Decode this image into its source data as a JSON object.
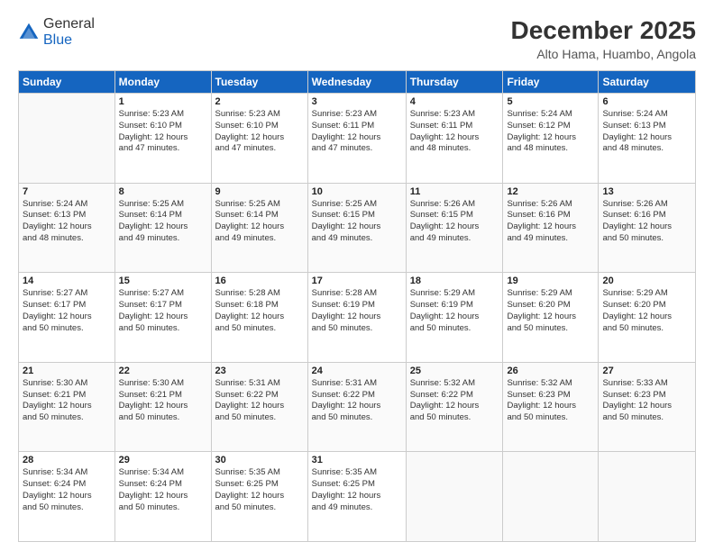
{
  "header": {
    "logo_general": "General",
    "logo_blue": "Blue",
    "month_title": "December 2025",
    "location": "Alto Hama, Huambo, Angola"
  },
  "days_of_week": [
    "Sunday",
    "Monday",
    "Tuesday",
    "Wednesday",
    "Thursday",
    "Friday",
    "Saturday"
  ],
  "weeks": [
    [
      {
        "day": "",
        "info": ""
      },
      {
        "day": "1",
        "info": "Sunrise: 5:23 AM\nSunset: 6:10 PM\nDaylight: 12 hours\nand 47 minutes."
      },
      {
        "day": "2",
        "info": "Sunrise: 5:23 AM\nSunset: 6:10 PM\nDaylight: 12 hours\nand 47 minutes."
      },
      {
        "day": "3",
        "info": "Sunrise: 5:23 AM\nSunset: 6:11 PM\nDaylight: 12 hours\nand 47 minutes."
      },
      {
        "day": "4",
        "info": "Sunrise: 5:23 AM\nSunset: 6:11 PM\nDaylight: 12 hours\nand 48 minutes."
      },
      {
        "day": "5",
        "info": "Sunrise: 5:24 AM\nSunset: 6:12 PM\nDaylight: 12 hours\nand 48 minutes."
      },
      {
        "day": "6",
        "info": "Sunrise: 5:24 AM\nSunset: 6:13 PM\nDaylight: 12 hours\nand 48 minutes."
      }
    ],
    [
      {
        "day": "7",
        "info": "Sunrise: 5:24 AM\nSunset: 6:13 PM\nDaylight: 12 hours\nand 48 minutes."
      },
      {
        "day": "8",
        "info": "Sunrise: 5:25 AM\nSunset: 6:14 PM\nDaylight: 12 hours\nand 49 minutes."
      },
      {
        "day": "9",
        "info": "Sunrise: 5:25 AM\nSunset: 6:14 PM\nDaylight: 12 hours\nand 49 minutes."
      },
      {
        "day": "10",
        "info": "Sunrise: 5:25 AM\nSunset: 6:15 PM\nDaylight: 12 hours\nand 49 minutes."
      },
      {
        "day": "11",
        "info": "Sunrise: 5:26 AM\nSunset: 6:15 PM\nDaylight: 12 hours\nand 49 minutes."
      },
      {
        "day": "12",
        "info": "Sunrise: 5:26 AM\nSunset: 6:16 PM\nDaylight: 12 hours\nand 49 minutes."
      },
      {
        "day": "13",
        "info": "Sunrise: 5:26 AM\nSunset: 6:16 PM\nDaylight: 12 hours\nand 50 minutes."
      }
    ],
    [
      {
        "day": "14",
        "info": "Sunrise: 5:27 AM\nSunset: 6:17 PM\nDaylight: 12 hours\nand 50 minutes."
      },
      {
        "day": "15",
        "info": "Sunrise: 5:27 AM\nSunset: 6:17 PM\nDaylight: 12 hours\nand 50 minutes."
      },
      {
        "day": "16",
        "info": "Sunrise: 5:28 AM\nSunset: 6:18 PM\nDaylight: 12 hours\nand 50 minutes."
      },
      {
        "day": "17",
        "info": "Sunrise: 5:28 AM\nSunset: 6:19 PM\nDaylight: 12 hours\nand 50 minutes."
      },
      {
        "day": "18",
        "info": "Sunrise: 5:29 AM\nSunset: 6:19 PM\nDaylight: 12 hours\nand 50 minutes."
      },
      {
        "day": "19",
        "info": "Sunrise: 5:29 AM\nSunset: 6:20 PM\nDaylight: 12 hours\nand 50 minutes."
      },
      {
        "day": "20",
        "info": "Sunrise: 5:29 AM\nSunset: 6:20 PM\nDaylight: 12 hours\nand 50 minutes."
      }
    ],
    [
      {
        "day": "21",
        "info": "Sunrise: 5:30 AM\nSunset: 6:21 PM\nDaylight: 12 hours\nand 50 minutes."
      },
      {
        "day": "22",
        "info": "Sunrise: 5:30 AM\nSunset: 6:21 PM\nDaylight: 12 hours\nand 50 minutes."
      },
      {
        "day": "23",
        "info": "Sunrise: 5:31 AM\nSunset: 6:22 PM\nDaylight: 12 hours\nand 50 minutes."
      },
      {
        "day": "24",
        "info": "Sunrise: 5:31 AM\nSunset: 6:22 PM\nDaylight: 12 hours\nand 50 minutes."
      },
      {
        "day": "25",
        "info": "Sunrise: 5:32 AM\nSunset: 6:22 PM\nDaylight: 12 hours\nand 50 minutes."
      },
      {
        "day": "26",
        "info": "Sunrise: 5:32 AM\nSunset: 6:23 PM\nDaylight: 12 hours\nand 50 minutes."
      },
      {
        "day": "27",
        "info": "Sunrise: 5:33 AM\nSunset: 6:23 PM\nDaylight: 12 hours\nand 50 minutes."
      }
    ],
    [
      {
        "day": "28",
        "info": "Sunrise: 5:34 AM\nSunset: 6:24 PM\nDaylight: 12 hours\nand 50 minutes."
      },
      {
        "day": "29",
        "info": "Sunrise: 5:34 AM\nSunset: 6:24 PM\nDaylight: 12 hours\nand 50 minutes."
      },
      {
        "day": "30",
        "info": "Sunrise: 5:35 AM\nSunset: 6:25 PM\nDaylight: 12 hours\nand 50 minutes."
      },
      {
        "day": "31",
        "info": "Sunrise: 5:35 AM\nSunset: 6:25 PM\nDaylight: 12 hours\nand 49 minutes."
      },
      {
        "day": "",
        "info": ""
      },
      {
        "day": "",
        "info": ""
      },
      {
        "day": "",
        "info": ""
      }
    ]
  ]
}
